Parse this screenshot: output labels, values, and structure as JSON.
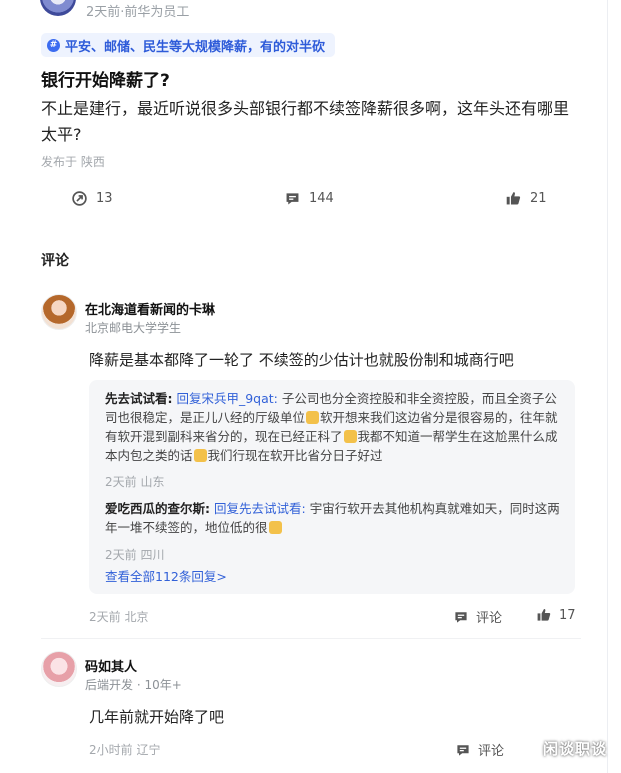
{
  "post": {
    "meta": "2天前·前华为员工",
    "topic": "平安、邮储、民生等大规模降薪，有的对半砍",
    "title": "银行开始降薪了?",
    "body": "不止是建行，最近听说很多头部银行都不续签降薪很多啊，这年头还有哪里太平?",
    "location": "发布于 陕西",
    "actions": {
      "repost_count": "13",
      "comment_count": "144",
      "like_count": "21"
    }
  },
  "comments_section": {
    "title": "评论"
  },
  "comments": [
    {
      "name": "在北海道看新闻的卡琳",
      "subtitle": "北京邮电大学学生",
      "text": "降薪是基本都降了一轮了 不续签的少估计也就股份制和城商行吧",
      "replies": [
        {
          "author": "先去试试看:",
          "reply_to": "回复宋兵甲_9qat:",
          "text_1": "子公司也分全资控股和非全资控股，而且全资子公司也很稳定，是正儿八经的厅级单位",
          "text_2": "软开想来我们这边省分是很容易的，往年就有软开混到副科来省分的，现在已经正科了",
          "text_3": "我都不知道一帮学生在这尬黑什么成本内包之类的话",
          "text_4": "我们行现在软开比省分日子好过",
          "meta": "2天前 山东"
        },
        {
          "author": "爱吃西瓜的查尔斯:",
          "reply_to": "回复先去试试看:",
          "text_1": "宇宙行软开去其他机构真就难如天，同时这两年一堆不续签的，地位低的很",
          "meta": "2天前 四川"
        }
      ],
      "see_all": "查看全部112条回复>",
      "footer_meta": "2天前 北京",
      "comment_label": "评论",
      "like_count": "17"
    },
    {
      "name": "码如其人",
      "subtitle": "后端开发 · 10年+",
      "text": "几年前就开始降了吧",
      "footer_meta": "2小时前 辽宁",
      "comment_label": "评论"
    }
  ],
  "watermark": "闲谈职谈",
  "colors": {
    "link": "#3261d8",
    "topic_bg": "#eef3fe",
    "reply_bg": "#f5f6f8"
  }
}
